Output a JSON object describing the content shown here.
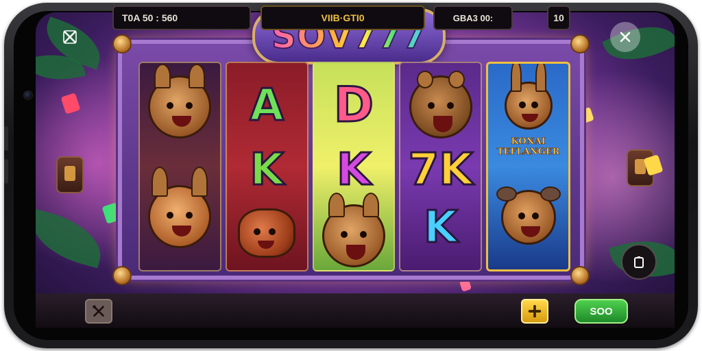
{
  "game": {
    "logo": "SOV777"
  },
  "reels": [
    {
      "symbols": [
        {
          "kind": "animal",
          "name": "hamster-warrior"
        },
        {
          "kind": "animal",
          "name": "fox-warrior"
        }
      ]
    },
    {
      "symbols": [
        {
          "kind": "letter",
          "text": "A",
          "color": "#6fe05a"
        },
        {
          "kind": "letter",
          "text": "K",
          "color": "#7adb4a"
        },
        {
          "kind": "animal",
          "name": "rolling-pig"
        }
      ]
    },
    {
      "symbols": [
        {
          "kind": "letter",
          "text": "D",
          "color": "#ff5a8a"
        },
        {
          "kind": "letter",
          "text": "K",
          "color": "#d44ae0"
        },
        {
          "kind": "animal",
          "name": "roaring-cat"
        }
      ]
    },
    {
      "symbols": [
        {
          "kind": "animal",
          "name": "roaring-bear"
        },
        {
          "kind": "letter",
          "text": "7K",
          "color": "#ffd038"
        },
        {
          "kind": "letter",
          "text": "K",
          "color": "#4ad0ff"
        }
      ]
    },
    {
      "symbols": [
        {
          "kind": "animal",
          "name": "rabbit-knight"
        },
        {
          "kind": "banner",
          "line1": "KONAI",
          "line2": "TEFLANGER"
        },
        {
          "kind": "animal",
          "name": "ram-horned-warrior"
        }
      ]
    }
  ],
  "bottom_bar": {
    "balance_text": "T0A 50 : 560",
    "center_text": "VIIB·GTI0",
    "bet_text": "GBA3 00:",
    "bet_value": "10",
    "spin_label": "SOO"
  }
}
